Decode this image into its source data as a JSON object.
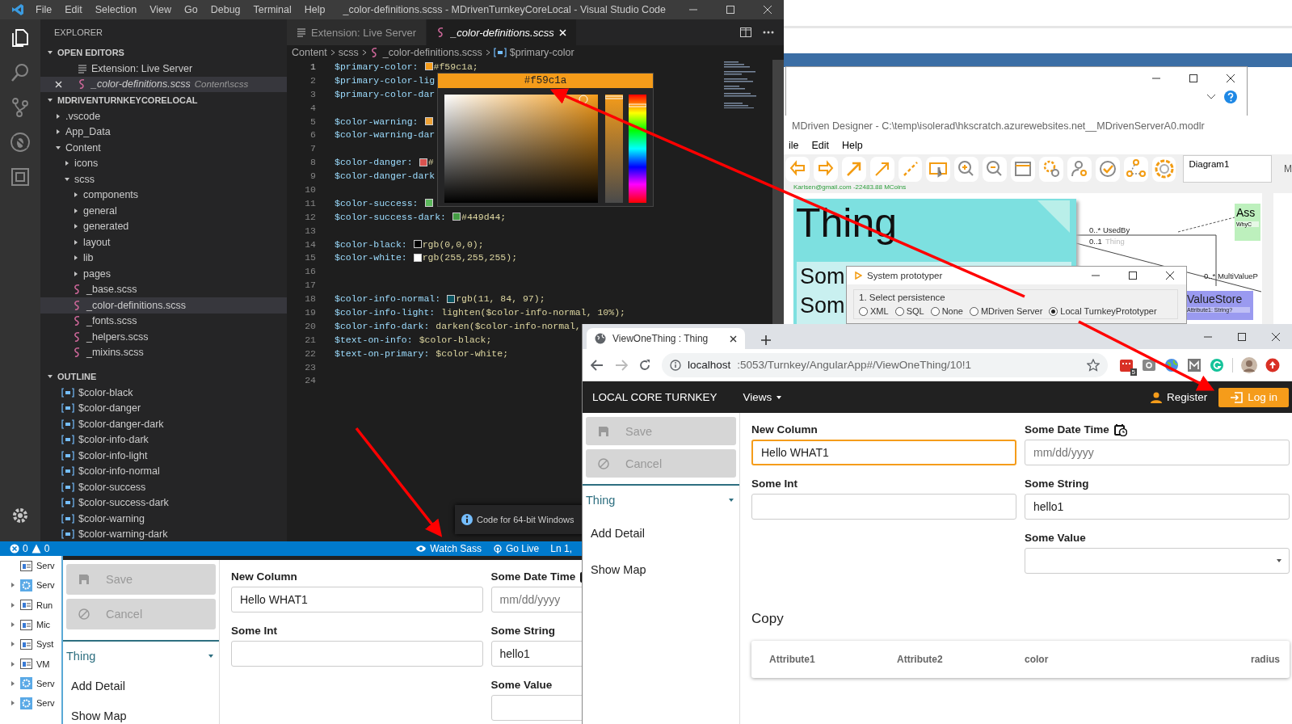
{
  "vscode": {
    "title": "_color-definitions.scss - MDrivenTurnkeyCoreLocal - Visual Studio Code",
    "menu": [
      "File",
      "Edit",
      "Selection",
      "View",
      "Go",
      "Debug",
      "Terminal",
      "Help"
    ],
    "activity": [
      {
        "kind": "files",
        "selected": true
      },
      {
        "kind": "search",
        "selected": false
      },
      {
        "kind": "git",
        "selected": false
      },
      {
        "kind": "debug",
        "selected": false
      },
      {
        "kind": "extensions",
        "selected": false
      }
    ],
    "sidebar_title": "EXPLORER",
    "open_editors": {
      "title": "OPEN EDITORS",
      "items": [
        {
          "name": "Extension: Live Server",
          "kind": "preview",
          "selected": false
        },
        {
          "name": "_color-definitions.scss",
          "path": "Content\\scss",
          "kind": "scss",
          "selected": true
        }
      ]
    },
    "project": {
      "title": "MDRIVENTURNKEYCORELOCAL",
      "tree": [
        {
          "name": ".vscode",
          "kind": "folder",
          "expanded": false,
          "selected": false
        },
        {
          "name": "App_Data",
          "kind": "folder",
          "expanded": false,
          "selected": false
        },
        {
          "name": "Content",
          "kind": "folder",
          "expanded": true,
          "selected": false,
          "children": [
            {
              "name": "icons",
              "kind": "folder",
              "expanded": false,
              "selected": false
            },
            {
              "name": "scss",
              "kind": "folder",
              "expanded": true,
              "selected": false,
              "children": [
                {
                  "name": "components",
                  "kind": "folder",
                  "expanded": false,
                  "selected": false
                },
                {
                  "name": "general",
                  "kind": "folder",
                  "expanded": false,
                  "selected": false
                },
                {
                  "name": "generated",
                  "kind": "folder",
                  "expanded": false,
                  "selected": false
                },
                {
                  "name": "layout",
                  "kind": "folder",
                  "expanded": false,
                  "selected": false
                },
                {
                  "name": "lib",
                  "kind": "folder",
                  "expanded": false,
                  "selected": false
                },
                {
                  "name": "pages",
                  "kind": "folder",
                  "expanded": false,
                  "selected": false
                },
                {
                  "name": "_base.scss",
                  "kind": "scss",
                  "selected": false
                },
                {
                  "name": "_color-definitions.scss",
                  "kind": "scss",
                  "selected": true
                },
                {
                  "name": "_fonts.scss",
                  "kind": "scss",
                  "selected": false
                },
                {
                  "name": "_helpers.scss",
                  "kind": "scss",
                  "selected": false
                },
                {
                  "name": "_mixins.scss",
                  "kind": "scss",
                  "selected": false
                }
              ]
            }
          ]
        }
      ]
    },
    "outline": {
      "title": "OUTLINE",
      "items": [
        "$color-black",
        "$color-danger",
        "$color-danger-dark",
        "$color-info-dark",
        "$color-info-light",
        "$color-info-normal",
        "$color-success",
        "$color-success-dark",
        "$color-warning",
        "$color-warning-dark"
      ]
    },
    "tabs": [
      {
        "label": "Extension: Live Server",
        "kind": "preview",
        "selected": false
      },
      {
        "label": "_color-definitions.scss",
        "kind": "scss",
        "selected": true
      }
    ],
    "breadcrumb": [
      {
        "label": "Content",
        "kind": "folder"
      },
      {
        "label": "scss",
        "kind": "folder"
      },
      {
        "label": "_color-definitions.scss",
        "kind": "scss"
      },
      {
        "label": "$primary-color",
        "kind": "variable"
      }
    ],
    "code": [
      {
        "number": "1",
        "selected": true,
        "name": "$primary-color:",
        "color": "#f59c1a",
        "value": "#f59c1a;"
      },
      {
        "number": "2",
        "selected": false,
        "name": "$primary-color-lig"
      },
      {
        "number": "3",
        "selected": false,
        "name": "$primary-color-dar"
      },
      {
        "number": "4",
        "selected": false
      },
      {
        "number": "5",
        "selected": false,
        "name": "$color-warning:",
        "color": "#eea236"
      },
      {
        "number": "6",
        "selected": false,
        "name": "$color-warning-dar"
      },
      {
        "number": "7",
        "selected": false
      },
      {
        "number": "8",
        "selected": false,
        "name": "$color-danger:",
        "color": "#d9534f",
        "value": "#"
      },
      {
        "number": "9",
        "selected": false,
        "name": "$color-danger-dark"
      },
      {
        "number": "10",
        "selected": false
      },
      {
        "number": "11",
        "selected": false,
        "name": "$color-success:",
        "color": "#5cb85c"
      },
      {
        "number": "12",
        "selected": false,
        "name": "$color-success-dark:",
        "color": "#449d44",
        "value": "#449d44;"
      },
      {
        "number": "13",
        "selected": false
      },
      {
        "number": "14",
        "selected": false,
        "name": "$color-black:",
        "color": "#000000",
        "value": "rgb(0,0,0);"
      },
      {
        "number": "15",
        "selected": false,
        "name": "$color-white:",
        "color": "#ffffff",
        "value": "rgb(255,255,255);"
      },
      {
        "number": "16",
        "selected": false
      },
      {
        "number": "17",
        "selected": false
      },
      {
        "number": "18",
        "selected": false,
        "name": "$color-info-normal:",
        "color": "#0b5461",
        "value": "rgb(11, 84, 97);"
      },
      {
        "number": "19",
        "selected": false,
        "name": "$color-info-light:",
        "value": "lighten($color-info-normal, 10%);"
      },
      {
        "number": "20",
        "selected": false,
        "name": "$color-info-dark:",
        "value": "darken($color-info-normal,"
      },
      {
        "number": "21",
        "selected": false,
        "name": "$text-on-info:",
        "value": "$color-black;"
      },
      {
        "number": "22",
        "selected": false,
        "name": "$text-on-primary:",
        "value": "$color-white;"
      },
      {
        "number": "23",
        "selected": false
      },
      {
        "number": "24",
        "selected": false
      }
    ],
    "picker": {
      "label": "#f59c1a",
      "color": "#f59c1a"
    },
    "notification": "Code for 64-bit Windows",
    "status": {
      "errors": "0",
      "warnings": "0",
      "items": [
        {
          "label": "Watch Sass",
          "kind": "eye"
        },
        {
          "label": "Go Live",
          "kind": "broadcast"
        },
        {
          "label": "Ln 1,",
          "kind": "text"
        }
      ]
    }
  },
  "designer": {
    "title": "MDriven Designer - C:\\temp\\isolerad\\hkscratch.azurewebsites.net__MDrivenServerA0.modlr",
    "menu": [
      "ile",
      "Edit",
      "Help"
    ],
    "diagram": "Diagram1",
    "side_label": "M",
    "account": "Karlsen@gmail.com -22483.88 MCoins",
    "thing": {
      "name": "Thing",
      "attributes": [
        "Som",
        "Som"
      ]
    },
    "roles": [
      {
        "text": "0..* UsedBy",
        "faded": false
      },
      {
        "text": "0..1",
        "faded": false
      },
      {
        "text": "Thing",
        "faded": true
      },
      {
        "text": "0..* MultiValueP",
        "faded": false
      }
    ],
    "assoc_class": {
      "name": "Ass",
      "attribute": "WhyC"
    },
    "valuestore": {
      "name": "ValueStore",
      "attribute": "Attribute1: String?"
    },
    "prototyper": {
      "title": "System prototyper",
      "group": "1. Select persistence",
      "options": [
        {
          "label": "XML",
          "selected": false
        },
        {
          "label": "SQL",
          "selected": false
        },
        {
          "label": "None",
          "selected": false
        },
        {
          "label": "MDriven Server",
          "selected": false
        },
        {
          "label": "Local TurnkeyPrototyper",
          "selected": true
        }
      ]
    }
  },
  "browser": {
    "tab": "ViewOneThing : Thing",
    "url_host": "localhost",
    "url_rest": ":5053/Turnkey/AngularApp#/ViewOneThing/10!1",
    "extension_badge": "5",
    "app": {
      "brand": "LOCAL CORE TURNKEY",
      "nav": "Views",
      "register": "Register",
      "login": "Log in",
      "actions": [
        {
          "label": "Save",
          "kind": "save",
          "disabled": true
        },
        {
          "label": "Cancel",
          "kind": "cancel",
          "disabled": true
        }
      ],
      "section": {
        "title": "Thing",
        "expanded": true
      },
      "links": [
        "Add Detail",
        "Show Map"
      ],
      "rows": [
        [
          {
            "label": "New Column",
            "kind": "text",
            "value": "Hello WHAT1",
            "focused": true
          },
          {
            "label": "Some Date Time",
            "kind": "date",
            "placeholder": "mm/dd/yyyy",
            "focused": false
          }
        ],
        [
          {
            "label": "Some Int",
            "kind": "text",
            "focused": false
          },
          {
            "label": "Some String",
            "kind": "text",
            "value": "hello1",
            "focused": false
          }
        ],
        [
          null,
          {
            "label": "Some Value",
            "kind": "select",
            "focused": false
          }
        ]
      ],
      "copy": {
        "title": "Copy",
        "columns": [
          "Attribute1",
          "Attribute2",
          "color",
          "radius"
        ]
      }
    }
  },
  "background_app": {
    "tree": [
      {
        "label": "Serv",
        "kind": "window"
      },
      {
        "label": "Serv",
        "kind": "gear",
        "expanded": false
      },
      {
        "label": "Run",
        "kind": "window",
        "expanded": false
      },
      {
        "label": "Mic",
        "kind": "window",
        "expanded": false
      },
      {
        "label": "Syst",
        "kind": "window",
        "expanded": false
      },
      {
        "label": "VM",
        "kind": "window",
        "expanded": false
      },
      {
        "label": "Serv",
        "kind": "gear",
        "expanded": false
      },
      {
        "label": "Serv",
        "kind": "gear",
        "expanded": false
      }
    ],
    "app": {
      "actions": [
        {
          "label": "Save",
          "kind": "save",
          "disabled": true
        },
        {
          "label": "Cancel",
          "kind": "cancel",
          "disabled": true
        }
      ],
      "section": {
        "title": "Thing",
        "expanded": true
      },
      "links": [
        "Add Detail",
        "Show Map"
      ],
      "rows": [
        [
          {
            "label": "New Column",
            "kind": "text",
            "value": "Hello WHAT1",
            "focused": false
          },
          {
            "label": "Some Date Time",
            "kind": "date",
            "placeholder": "mm/dd/yyyy",
            "focused": false
          }
        ],
        [
          {
            "label": "Some Int",
            "kind": "text",
            "focused": false
          },
          {
            "label": "Some String",
            "kind": "text",
            "value": "hello1",
            "focused": false
          }
        ],
        [
          null,
          {
            "label": "Some Value",
            "kind": "select",
            "focused": false
          }
        ]
      ]
    }
  }
}
